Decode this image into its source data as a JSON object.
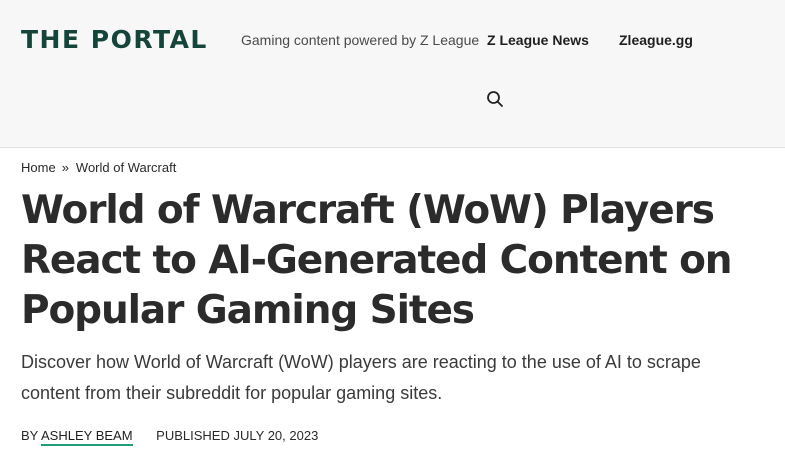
{
  "header": {
    "logo_text": "THE PORTAL",
    "tagline": "Gaming content powered by Z League",
    "nav": [
      {
        "label": "Z League News"
      },
      {
        "label": "Zleague.gg"
      }
    ],
    "search_icon": "search-icon"
  },
  "breadcrumb": {
    "home": "Home",
    "separator": "»",
    "category": "World of Warcraft"
  },
  "article": {
    "title": "World of Warcraft (WoW) Players React to AI-Generated Content on Popular Gaming Sites",
    "subtitle": "Discover how World of Warcraft (WoW) players are reacting to the use of AI to scrape content from their subreddit for popular gaming sites.",
    "byline": {
      "by_label": "BY",
      "author": "ASHLEY BEAM",
      "published_label": "PUBLISHED",
      "date": "JULY 20, 2023"
    }
  },
  "colors": {
    "brand": "#14443a",
    "accent_underline": "#1e9e7a",
    "header_bg": "#f7f7f7"
  }
}
